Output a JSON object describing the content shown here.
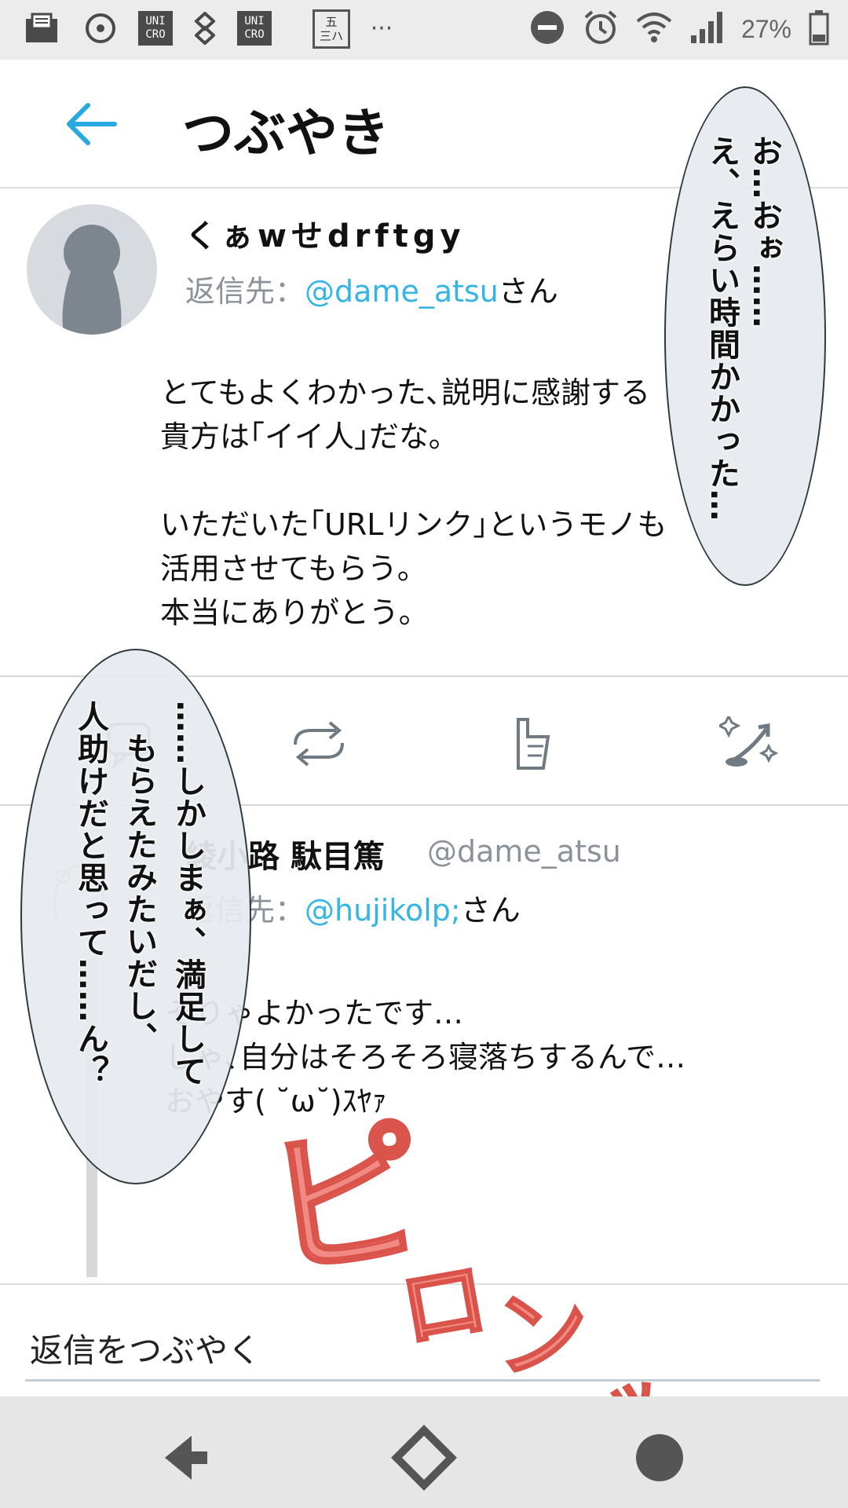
{
  "status_bar": {
    "left_icons": [
      "mail-icon",
      "disc-icon",
      "uniqlo-icon",
      "diamond-chain-icon",
      "uniqlo-icon",
      "kanji-app-icon",
      "more-icon"
    ],
    "uniqlo_label": "UNI\nCRO",
    "kanji_app_label": "五\n三ハ",
    "more": "···",
    "battery": "27%"
  },
  "header": {
    "title": "つぶやき"
  },
  "tweet1": {
    "name": "くぁwせdrftgy",
    "reply_prefix": "返信先：",
    "reply_mention": "@dame_atsu",
    "reply_suffix": "さん",
    "body": "とてもよくわかった､説明に感謝する\n貴方は｢イイ人｣だな｡\n\nいただいた｢URLリンク｣というモノも\n活用させてもらう｡\n本当にありがとう｡"
  },
  "actions": [
    "reply-icon",
    "retweet-icon",
    "like-icon",
    "share-icon"
  ],
  "tweet2": {
    "name": "綾小路 駄目篤",
    "handle": "@dame_atsu",
    "reply_prefix": "返信先：",
    "reply_mention": "@hujikolp;",
    "reply_suffix": "さん",
    "body": "そりゃよかったです…\nじゃ､自分はそろそろ寝落ちするんで…\nおやす( ˘ω˘)ｽﾔｧ"
  },
  "reply_placeholder": "返信をつぶやく",
  "bubble_top": {
    "col1": "お…おぉ……",
    "col2": "え、えらい時間かかった…"
  },
  "bubble_left": {
    "col1": "……しかしまぁ、満足して",
    "col2": "もらえたみたいだし、",
    "col3": "人助けだと思って……ん？"
  },
  "sfx": {
    "chars": [
      "ピ",
      "ロ",
      "ン",
      "ッ"
    ],
    "color": "#f08a82"
  },
  "nav": [
    "back-icon",
    "home-icon",
    "recents-icon"
  ]
}
